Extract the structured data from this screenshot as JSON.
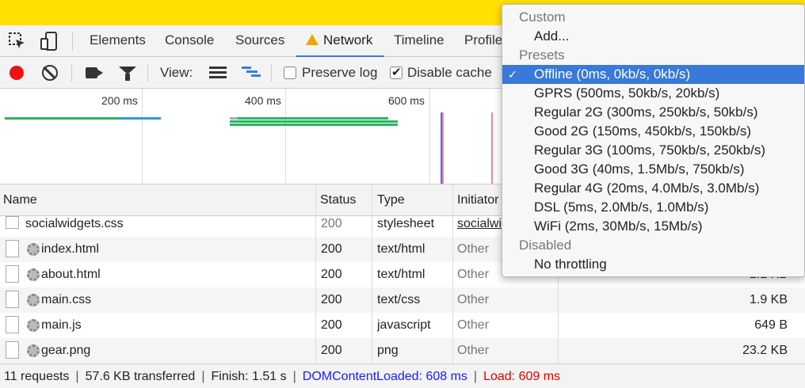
{
  "tabs": [
    {
      "label": "Elements"
    },
    {
      "label": "Console"
    },
    {
      "label": "Sources"
    },
    {
      "label": "Network"
    },
    {
      "label": "Timeline"
    },
    {
      "label": "Profile"
    }
  ],
  "toolbar": {
    "view_label": "View:",
    "preserve_log": {
      "label": "Preserve log",
      "checked": false
    },
    "disable_cache": {
      "label": "Disable cache",
      "checked": true
    }
  },
  "timeline": {
    "ticks": [
      "200 ms",
      "400 ms",
      "600 ms"
    ]
  },
  "table": {
    "columns": [
      "Name",
      "Status",
      "Type",
      "Initiator"
    ],
    "rows": [
      {
        "name": "socialwidgets.css",
        "status": "200",
        "type": "stylesheet",
        "initiator": "socialwi",
        "size": ""
      },
      {
        "name": "index.html",
        "status": "200",
        "type": "text/html",
        "initiator": "Other",
        "size": ""
      },
      {
        "name": "about.html",
        "status": "200",
        "type": "text/html",
        "initiator": "Other",
        "size": "2.2 KB"
      },
      {
        "name": "main.css",
        "status": "200",
        "type": "text/css",
        "initiator": "Other",
        "size": "1.9 KB"
      },
      {
        "name": "main.js",
        "status": "200",
        "type": "javascript",
        "initiator": "Other",
        "size": "649 B"
      },
      {
        "name": "gear.png",
        "status": "200",
        "type": "png",
        "initiator": "Other",
        "size": "23.2 KB"
      }
    ]
  },
  "status": {
    "requests": "11 requests",
    "transferred": "57.6 KB transferred",
    "finish": "Finish: 1.51 s",
    "dom": "DOMContentLoaded: 608 ms",
    "load": "Load: 609 ms",
    "sep": "|",
    "dom_color": "#1a1aff",
    "load_color": "#e00000"
  },
  "throttling": {
    "custom_header": "Custom",
    "add": "Add...",
    "presets_header": "Presets",
    "presets": [
      "Offline (0ms, 0kb/s, 0kb/s)",
      "GPRS (500ms, 50kb/s, 20kb/s)",
      "Regular 2G (300ms, 250kb/s, 50kb/s)",
      "Good 2G (150ms, 450kb/s, 150kb/s)",
      "Regular 3G (100ms, 750kb/s, 250kb/s)",
      "Good 3G (40ms, 1.5Mb/s, 750kb/s)",
      "Regular 4G (20ms, 4.0Mb/s, 3.0Mb/s)",
      "DSL (5ms, 2.0Mb/s, 1.0Mb/s)",
      "WiFi (2ms, 30Mb/s, 15Mb/s)"
    ],
    "selected": "Offline (0ms, 0kb/s, 0kb/s)",
    "check_mark": "✓",
    "disabled_header": "Disabled",
    "no_throttling": "No throttling"
  },
  "colors": {
    "topbar": "#ffe000",
    "accent": "#3879d9",
    "record": "#e11111"
  }
}
